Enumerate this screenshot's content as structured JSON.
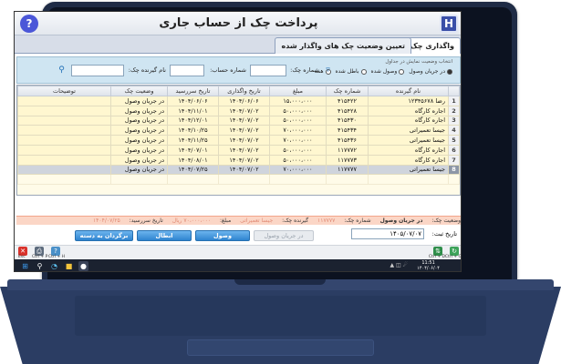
{
  "app": {
    "title": "پرداخت چک از حساب جاری",
    "logo_glyph": "?",
    "app_icon_glyph": "H"
  },
  "tabs": [
    {
      "label": "واگذاری چک",
      "active": true
    },
    {
      "label": "تعیین وضعیت چک های واگذار شده",
      "active": false
    }
  ],
  "filter": {
    "group_title": "انتخاب وضعیت نمایش در جداول",
    "radios": [
      {
        "label": "در جریان وصول",
        "checked": true
      },
      {
        "label": "وصول شده",
        "checked": false
      },
      {
        "label": "باطل شده",
        "checked": false
      },
      {
        "label": "همه",
        "checked": false
      }
    ],
    "check_number_label": "شماره چک:",
    "account_number_label": "شماره حساب:",
    "payee_label": "نام گیرنده چک:",
    "check_number_value": "",
    "account_number_value": "",
    "payee_value": ""
  },
  "grid": {
    "columns": [
      "نام گیرنده",
      "شماره چک",
      "مبلغ",
      "تاریخ واگذاری",
      "تاریخ سررسید",
      "وضعیت چک",
      "توضیحات"
    ],
    "rows": [
      {
        "num": "1",
        "payee": "رضا ۱۲۳۴۵۶۷۸",
        "check": "۴۱۵۴۲۲",
        "amount": "۱۵،۰۰۰،۰۰۰",
        "assign_date": "۱۴۰۴/۰۶/۰۶",
        "due_date": "۱۴۰۴/۰۶/۰۶",
        "status": "در جریان وصول",
        "desc": ""
      },
      {
        "num": "2",
        "payee": "اجاره کارگاه",
        "check": "۴۱۵۴۲۸",
        "amount": "۵۰،۰۰۰،۰۰۰",
        "assign_date": "۱۴۰۴/۰۷/۰۲",
        "due_date": "۱۴۰۴/۱۱/۰۱",
        "status": "در جریان وصول",
        "desc": ""
      },
      {
        "num": "3",
        "payee": "اجاره کارگاه",
        "check": "۴۱۵۴۳۰",
        "amount": "۵۰،۰۰۰،۰۰۰",
        "assign_date": "۱۴۰۴/۰۷/۰۲",
        "due_date": "۱۴۰۴/۱۲/۰۱",
        "status": "در جریان وصول",
        "desc": ""
      },
      {
        "num": "4",
        "payee": "جیسا تعمیراتی",
        "check": "۴۱۵۴۳۴",
        "amount": "۷۰،۰۰۰،۰۰۰",
        "assign_date": "۱۴۰۴/۰۷/۰۲",
        "due_date": "۱۴۰۴/۱۰/۲۵",
        "status": "در جریان وصول",
        "desc": ""
      },
      {
        "num": "5",
        "payee": "جیسا تعمیراتی",
        "check": "۴۱۵۴۳۶",
        "amount": "۷۰،۰۰۰،۰۰۰",
        "assign_date": "۱۴۰۴/۰۷/۰۲",
        "due_date": "۱۴۰۴/۱۱/۲۵",
        "status": "در جریان وصول",
        "desc": ""
      },
      {
        "num": "6",
        "payee": "اجاره کارگاه",
        "check": "۱۱۷۷۷۲",
        "amount": "۵۰،۰۰۰،۰۰۰",
        "assign_date": "۱۴۰۴/۰۷/۰۲",
        "due_date": "۱۴۰۴/۰۷/۰۱",
        "status": "در جریان وصول",
        "desc": ""
      },
      {
        "num": "7",
        "payee": "اجاره کارگاه",
        "check": "۱۱۷۷۷۳",
        "amount": "۵۰،۰۰۰،۰۰۰",
        "assign_date": "۱۴۰۴/۰۷/۰۲",
        "due_date": "۱۴۰۴/۰۸/۰۱",
        "status": "در جریان وصول",
        "desc": ""
      },
      {
        "num": "8",
        "payee": "جیسا تعمیراتی",
        "check": "۱۱۷۷۷۷",
        "amount": "۷۰،۰۰۰،۰۰۰",
        "assign_date": "۱۴۰۴/۰۷/۰۲",
        "due_date": "۱۴۰۴/۰۷/۲۵",
        "status": "در جریان وصول",
        "desc": "",
        "selected": true
      }
    ]
  },
  "detail": {
    "status_label": "وضعیت چک:",
    "status_value": "در جریان وصول",
    "check_number_label": "شماره چک:",
    "check_number_value": "۱۱۷۷۷۷",
    "payee_label": "گیرنده چک:",
    "payee_value": "جیسا تعمیراتی",
    "amount_label": "مبلغ:",
    "amount_value": "۷۰،۰۰۰،۰۰۰ ریال",
    "due_label": "تاریخ سررسید:",
    "due_value": "۱۴۰۴/۰۷/۲۵"
  },
  "date_filter": {
    "label": "تاریخ ثبت:",
    "value": "۱۴۰۵/۰۷/۰۷"
  },
  "actions": {
    "in_progress": "در جریان وصول",
    "collected": "وصول",
    "void": "ابطال",
    "return": "برگردان به دسته چک"
  },
  "toolbar": {
    "esc": "Esc",
    "ctrl_p": "Ctrl + P",
    "ctrl_h": "Ctrl + H",
    "ctrl_d": "Ctrl + D",
    "ctrl_g": "Ctrl + G"
  },
  "taskbar": {
    "time": "11:51",
    "date": "۱۴۰۴/۰۶/۰۴"
  },
  "colors": {
    "accent": "#2e84cf",
    "grid_row": "#fff7d0",
    "detail_bg": "#fbd6c6",
    "filter_bg": "#cfe5f2"
  }
}
